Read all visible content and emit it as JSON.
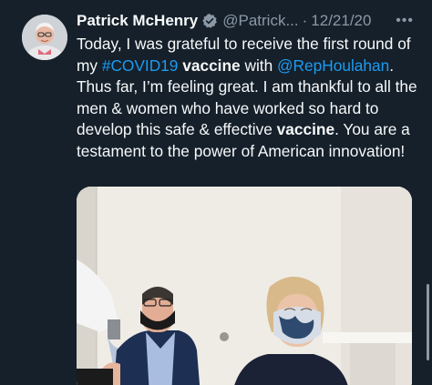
{
  "author": {
    "name": "Patrick McHenry",
    "handle": "@Patrick...",
    "separator": "·",
    "date": "12/21/20",
    "avatar_icon": "profile-photo"
  },
  "more_icon": "more-icon",
  "tweet": {
    "t1": "Today, I was grateful to receive the first round of my ",
    "hashtag": "#COVID19",
    "t2": " ",
    "bold1": "vaccine",
    "t3": " with ",
    "mention": "@RepHoulahan",
    "t4": ". Thus far, I’m feeling great. I am thankful to all the men & women who have worked so hard to develop this safe & effective ",
    "bold2": "vaccine",
    "t5": ". You are a testament to the power of American innovation!"
  },
  "media": {
    "icon": "photo"
  },
  "colors": {
    "background": "#15202b",
    "text": "#f7f9f9",
    "muted": "#8b98a5",
    "link": "#1d9bf0"
  }
}
